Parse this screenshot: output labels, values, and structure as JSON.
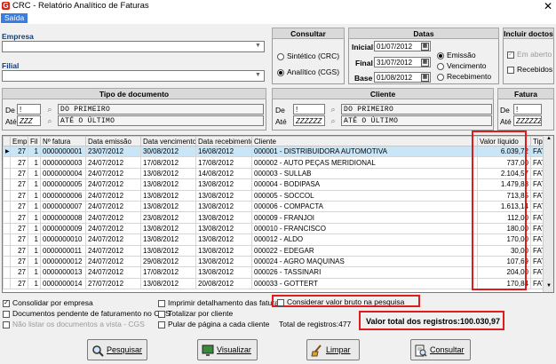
{
  "window": {
    "title": "CRC - Relatório Analítico de Faturas",
    "close": "✕"
  },
  "menu": {
    "saida": "Saída"
  },
  "empresa": {
    "label": "Empresa",
    "value": "",
    "filial_label": "Filial",
    "filial_value": ""
  },
  "consultar": {
    "header": "Consultar",
    "sintetico": "Sintético (CRC)",
    "analitico": "Analítico (CGS)",
    "selected": "analitico"
  },
  "datas": {
    "header": "Datas",
    "inicial_label": "Inicial",
    "inicial": "01/07/2012",
    "final_label": "Final",
    "final": "31/07/2012",
    "base_label": "Base",
    "base": "01/08/2012",
    "emissao": "Emissão",
    "vencimento": "Vencimento",
    "recebimento": "Recebimento",
    "selected": "emissao"
  },
  "incluir": {
    "header": "Incluir doctos",
    "em_aberto": "Em aberto",
    "recebidos": "Recebidos"
  },
  "tipo_documento": {
    "header": "Tipo de documento",
    "de_label": "De",
    "de_code": "!",
    "de_name": "DO PRIMEIRO",
    "ate_label": "Até",
    "ate_code": "ZZZ",
    "ate_name": "ATÉ O ÚLTIMO"
  },
  "cliente": {
    "header": "Cliente",
    "de_label": "De",
    "de_code": "!",
    "de_name": "DO PRIMEIRO",
    "ate_label": "Até",
    "ate_code": "ZZZZZZ",
    "ate_name": "ATÉ O ÚLTIMO"
  },
  "fatura": {
    "header": "Fatura",
    "de_label": "De",
    "de_code": "!",
    "ate_label": "Até",
    "ate_code": "ZZZZZZZ"
  },
  "grid": {
    "columns": [
      "Emp",
      "Fil",
      "Nº fatura",
      "Data emissão",
      "Data vencimento",
      "Data recebimento",
      "Cliente",
      "Valor líquido",
      "Tipo"
    ],
    "rows": [
      [
        "27",
        "1",
        "0000000001",
        "23/07/2012",
        "30/08/2012",
        "16/08/2012",
        "000001 - DISTRIBUIDORA AUTOMOTIVA",
        "6.039,72",
        "FAT"
      ],
      [
        "27",
        "1",
        "0000000003",
        "24/07/2012",
        "17/08/2012",
        "17/08/2012",
        "000002 - AUTO PEÇAS MERIDIONAL",
        "737,00",
        "FAT"
      ],
      [
        "27",
        "1",
        "0000000004",
        "24/07/2012",
        "13/08/2012",
        "14/08/2012",
        "000003 - SULLAB",
        "2.104,57",
        "FAT"
      ],
      [
        "27",
        "1",
        "0000000005",
        "24/07/2012",
        "13/08/2012",
        "13/08/2012",
        "000004 - BODIPASA",
        "1.479,88",
        "FAT"
      ],
      [
        "27",
        "1",
        "0000000006",
        "24/07/2012",
        "13/08/2012",
        "13/08/2012",
        "000005 - SOCCOL",
        "713,85",
        "FAT"
      ],
      [
        "27",
        "1",
        "0000000007",
        "24/07/2012",
        "13/08/2012",
        "13/08/2012",
        "000006 - COMPACTA",
        "1.613,14",
        "FAT"
      ],
      [
        "27",
        "1",
        "0000000008",
        "24/07/2012",
        "23/08/2012",
        "13/08/2012",
        "000009 - FRANJOI",
        "112,00",
        "FAT"
      ],
      [
        "27",
        "1",
        "0000000009",
        "24/07/2012",
        "13/08/2012",
        "13/08/2012",
        "000010 - FRANCISCO",
        "180,00",
        "FAT"
      ],
      [
        "27",
        "1",
        "0000000010",
        "24/07/2012",
        "13/08/2012",
        "13/08/2012",
        "000012 - ALDO",
        "170,00",
        "FAT"
      ],
      [
        "27",
        "1",
        "0000000011",
        "24/07/2012",
        "13/08/2012",
        "13/08/2012",
        "000022 - EDEGAR",
        "30,00",
        "FAT"
      ],
      [
        "27",
        "1",
        "0000000012",
        "24/07/2012",
        "29/08/2012",
        "13/08/2012",
        "000024 - AGRO MAQUINAS",
        "107,69",
        "FAT"
      ],
      [
        "27",
        "1",
        "0000000013",
        "24/07/2012",
        "17/08/2012",
        "13/08/2012",
        "000026 - TASSINARI",
        "204,00",
        "FAT"
      ],
      [
        "27",
        "1",
        "0000000014",
        "27/07/2012",
        "13/08/2012",
        "20/08/2012",
        "000033 - GOTTERT",
        "170,84",
        "FAT"
      ]
    ]
  },
  "options": {
    "consolidar": "Consolidar por empresa",
    "pendentes": "Documentos pendente de faturamento no CGS",
    "nao_listar": "Não listar os documentos a vista - CGS",
    "imprimir": "Imprimir detalhamento das faturas",
    "totalizar": "Totalizar por cliente",
    "pular": "Pular de página a cada cliente",
    "bruto": "Considerar valor bruto na pesquisa"
  },
  "totals": {
    "registros": "Total de registros:477",
    "valor_total": "Valor total dos registros:100.030,97"
  },
  "buttons": {
    "pesquisar": "Pesquisar",
    "visualizar": "Visualizar",
    "limpar": "Limpar",
    "consultar": "Consultar"
  }
}
